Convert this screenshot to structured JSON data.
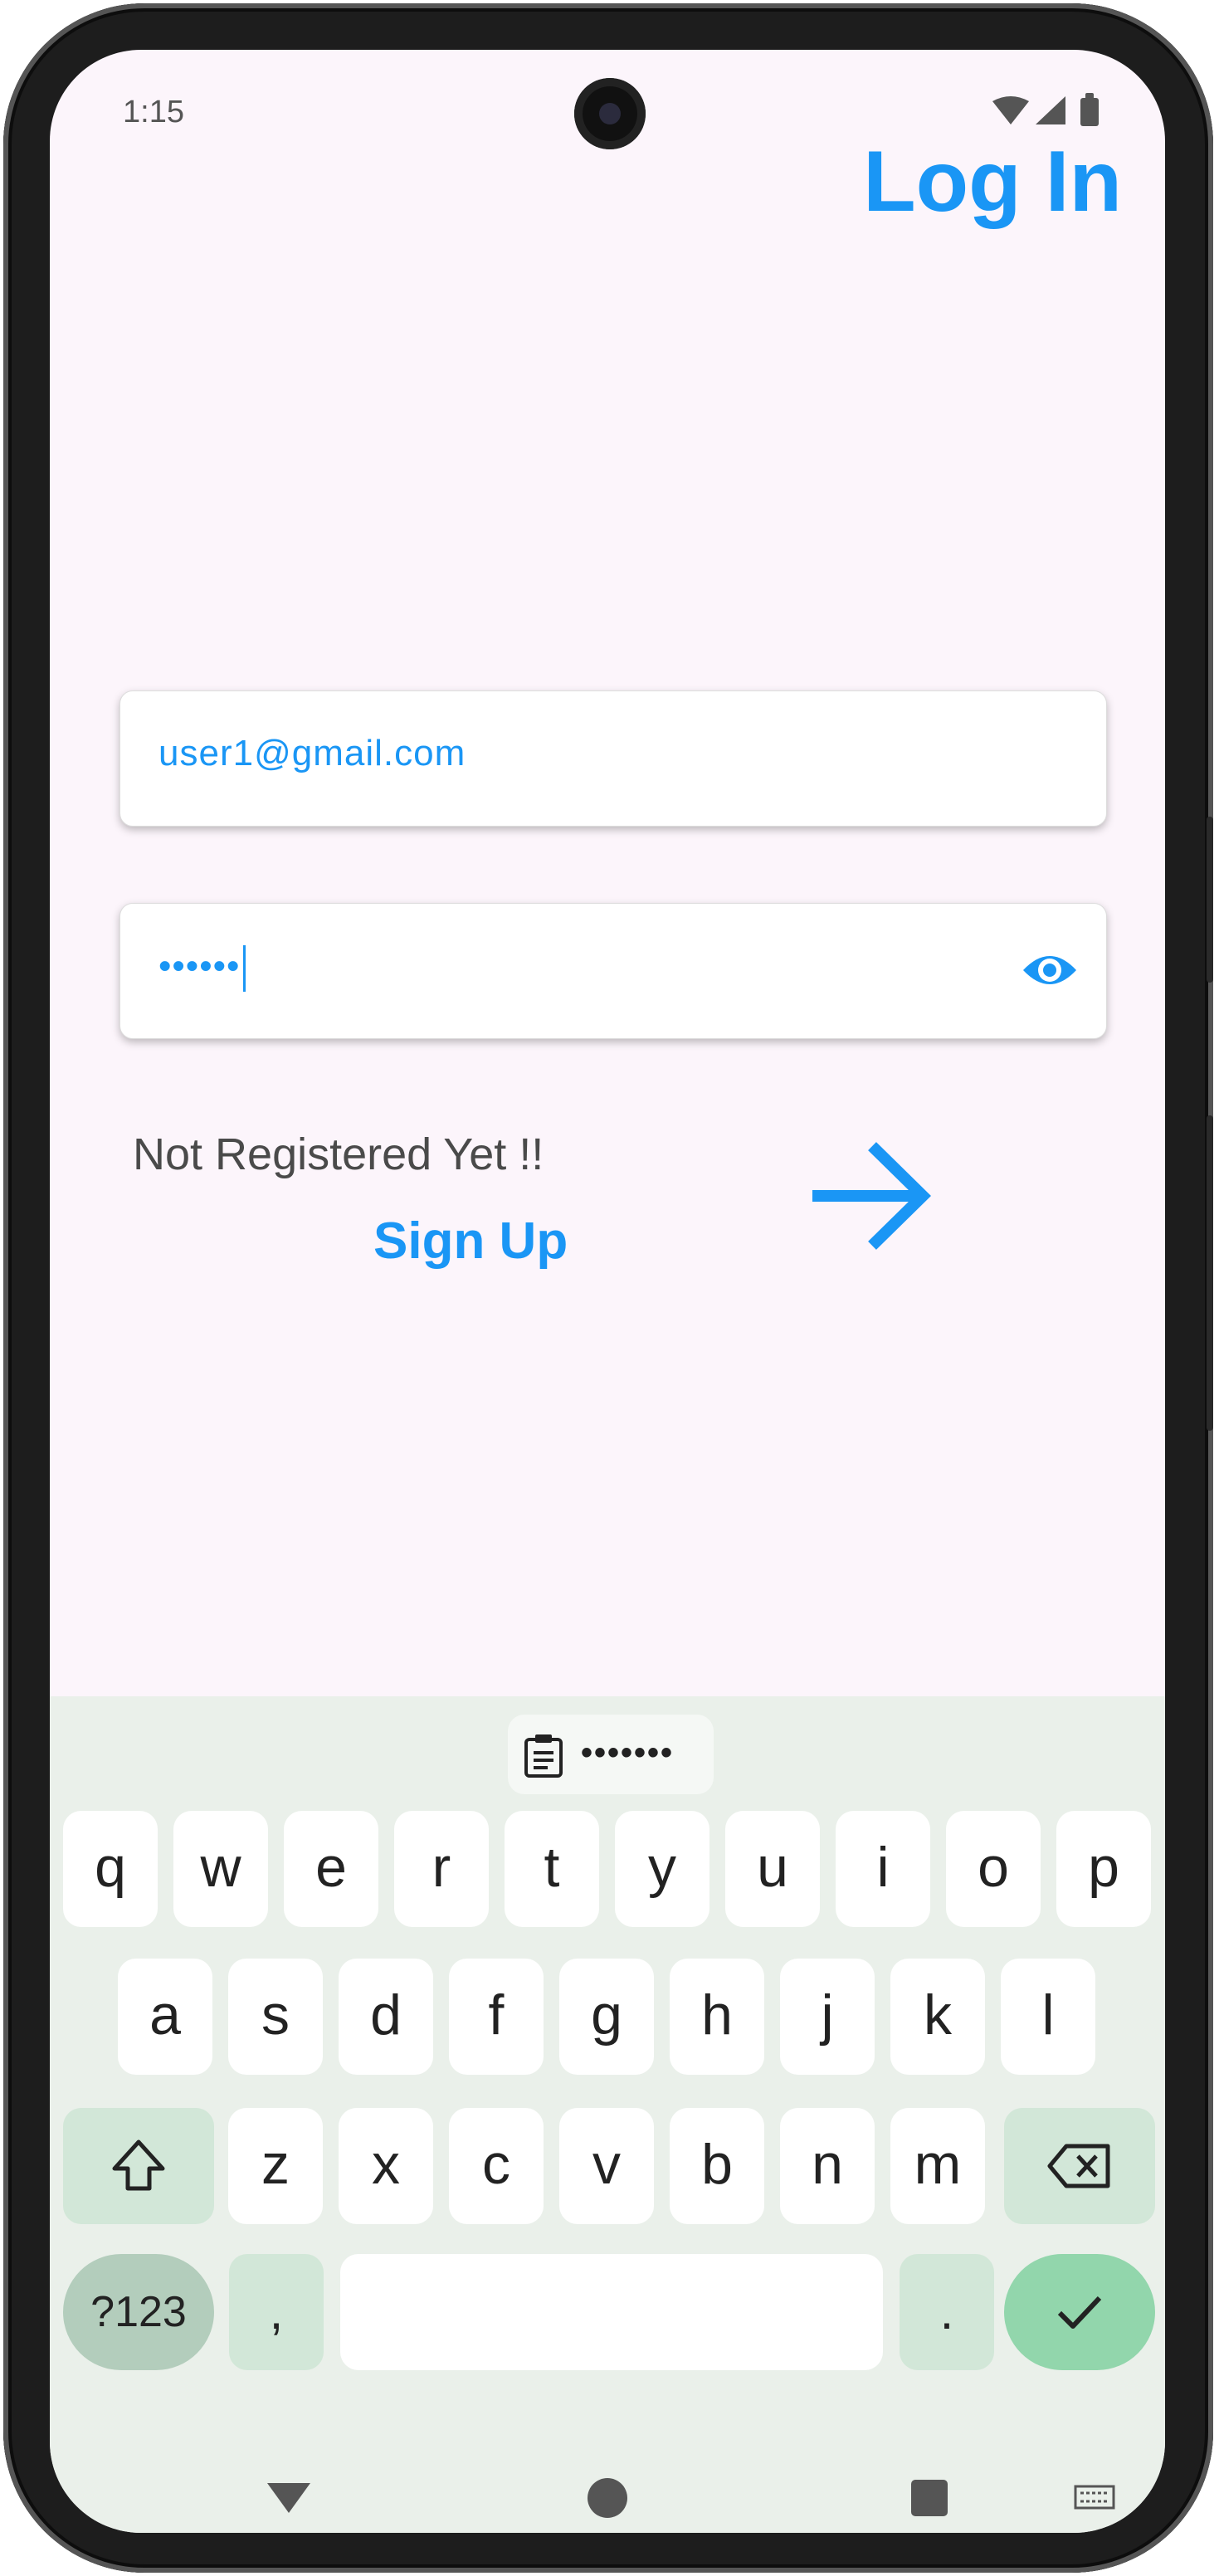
{
  "status_bar": {
    "time": "1:15",
    "icons": [
      "wifi-icon",
      "signal-icon",
      "battery-icon"
    ]
  },
  "header": {
    "title": "Log In"
  },
  "form": {
    "email_value": "user1@gmail.com",
    "password_value": "••••••",
    "toggle_icon": "eye-icon"
  },
  "register": {
    "prompt": "Not Registered Yet !!",
    "signup_label": "Sign Up",
    "submit_icon": "arrow-right-icon"
  },
  "keyboard": {
    "clipboard_suggestion": "•••••••",
    "row1": [
      "q",
      "w",
      "e",
      "r",
      "t",
      "y",
      "u",
      "i",
      "o",
      "p"
    ],
    "row2": [
      "a",
      "s",
      "d",
      "f",
      "g",
      "h",
      "j",
      "k",
      "l"
    ],
    "row3": [
      "z",
      "x",
      "c",
      "v",
      "b",
      "n",
      "m"
    ],
    "symbols_label": "?123",
    "comma_label": ",",
    "period_label": "."
  },
  "nav_bar": {
    "icons": [
      "back-icon",
      "home-icon",
      "recents-icon",
      "keyboard-switch-icon"
    ]
  },
  "colors": {
    "accent": "#1a96f5",
    "background": "#fcf5fb",
    "keyboard_bg": "#eaf0ea",
    "enter_key": "#92d6ac"
  }
}
